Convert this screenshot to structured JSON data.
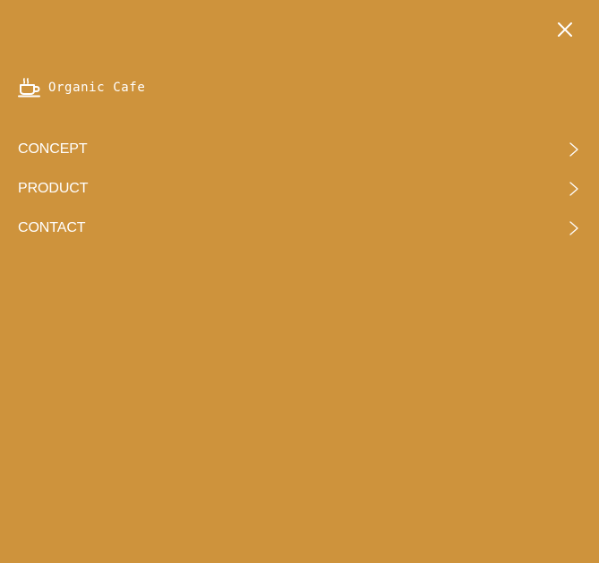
{
  "theme": {
    "background": "#CE933C",
    "foreground": "#FFFFFF"
  },
  "header": {
    "close_icon": "close-icon"
  },
  "brand": {
    "name": "Organic Cafe",
    "icon": "coffee-cup-icon"
  },
  "menu": {
    "items": [
      {
        "label": "CONCEPT",
        "icon": "chevron-right-icon"
      },
      {
        "label": "PRODUCT",
        "icon": "chevron-right-icon"
      },
      {
        "label": "CONTACT",
        "icon": "chevron-right-icon"
      }
    ]
  }
}
